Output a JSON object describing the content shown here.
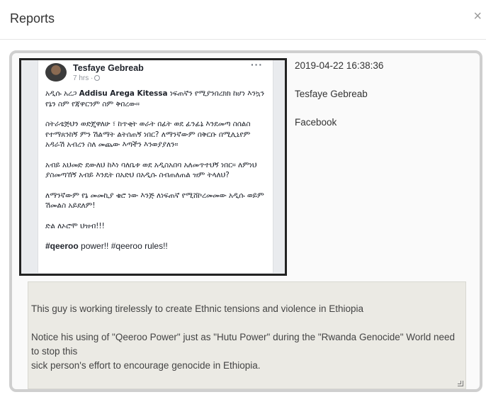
{
  "modal": {
    "title": "Reports",
    "close_label": "×"
  },
  "post": {
    "author": "Tesfaye Gebreab",
    "time": "7 hrs ·",
    "more": "···",
    "para1_prefix": "አዲሱ አረጋ",
    "para1_bold": "Addisu Arega Kitessa",
    "para1_suffix": "ነፍጠኛን የሚያንበረክክ ከሆነ እንኳን የኔን ስም የጃዋርንም ስም ቅበረው።",
    "para2": "ስትራቴጅህን ወድጄዋለሁ ፣ ከጥቂት ወራት በፊት ወደ ፊንፊኔ እንደመጣ ስሰልስ የተማጸንከኝ ምን ሽልማት ልትሰጠኝ ነበር? ለማንኛውም በቅርቡ በሚሊኒየም አዳራሽ አብረን ስለ መጨው እጣችን እንወያያለን።",
    "para3": "አብይ አህመድ ደውለህ ከእነ ባለቤቱ ወደ አዲስአበባ አለመጥተህኝ ነበር። ለምነህ ያስመጣኸኝ አብይ እንዴት በአድህ በአዲሱ ስብጠለጠል ዝም ትላለህ?",
    "para4": "ለማንኛውም የኔ መመኪያ ቄሮ ነው እንጅ ለነፍጠኛ የሚሸኮረመመው አዲሱ ወይም ሽመልስ አይደለም!",
    "para5": "ድል ለኦሮሞ ህዝብ!!!",
    "hashtag_bold": "#qeeroo",
    "hashtag_rest": "power!!  #qeeroo rules!!"
  },
  "meta": {
    "date": "2019-04-22 16:38:36",
    "author": "Tesfaye Gebreab",
    "source": "Facebook"
  },
  "comment": {
    "text": "This guy is working tirelessly to create Ethnic tensions and violence in Ethiopia\n\nNotice his using of \"Qeeroo Power\" just as \"Hutu Power\" during the \"Rwanda Genocide\"  World need to stop this\nsick person's effort to encourage genocide in Ethiopia."
  },
  "icons": {
    "close": "close-icon",
    "globe": "globe-icon",
    "more": "more-options-icon"
  }
}
